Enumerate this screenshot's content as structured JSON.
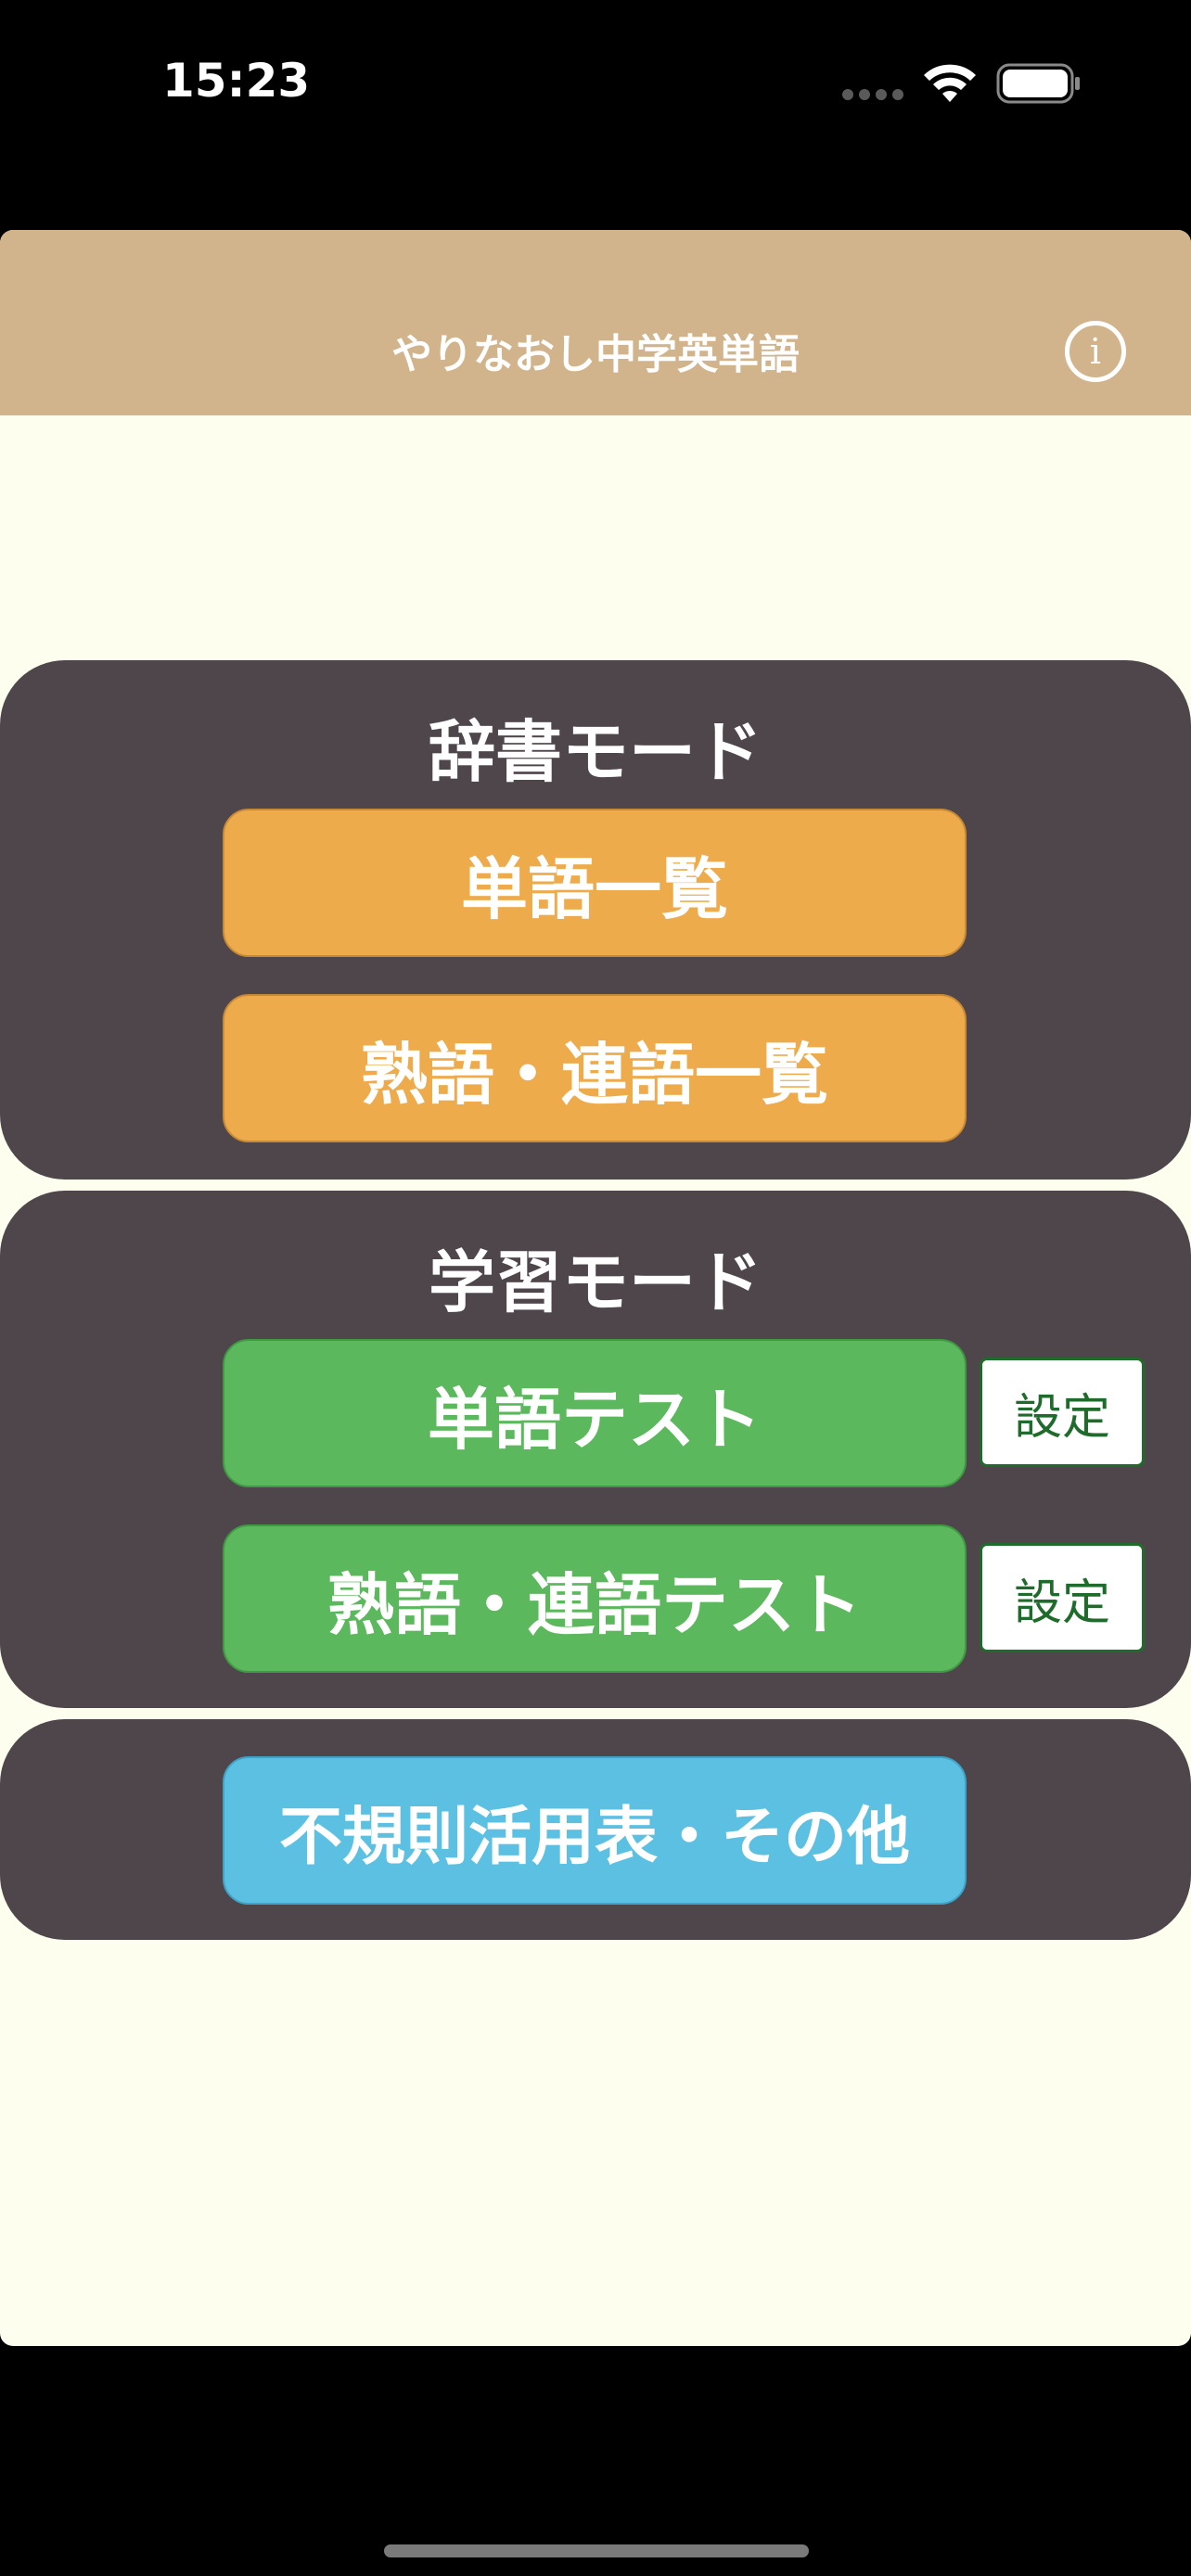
{
  "status_bar": {
    "time": "15:23",
    "icons": [
      "signal-dots-icon",
      "wifi-icon",
      "battery-icon"
    ]
  },
  "nav": {
    "title": "やりなおし中学英単語",
    "info_icon": "info-icon",
    "info_glyph": "i"
  },
  "dictionary_section": {
    "title": "辞書モード",
    "buttons": [
      {
        "label": "単語一覧"
      },
      {
        "label": "熟語・連語一覧"
      }
    ]
  },
  "study_section": {
    "title": "学習モード",
    "buttons": [
      {
        "label": "単語テスト",
        "settings_label": "設定"
      },
      {
        "label": "熟語・連語テスト",
        "settings_label": "設定"
      }
    ]
  },
  "other_section": {
    "buttons": [
      {
        "label": "不規則活用表・その他"
      }
    ]
  },
  "colors": {
    "nav_background": "#d1b38c",
    "page_background": "#fefeef",
    "panel": "#4e464b",
    "dictionary_button": "#eeab4c",
    "study_button": "#5bb85d",
    "other_button": "#5bc0e2",
    "settings_text": "#1f6b2c"
  }
}
